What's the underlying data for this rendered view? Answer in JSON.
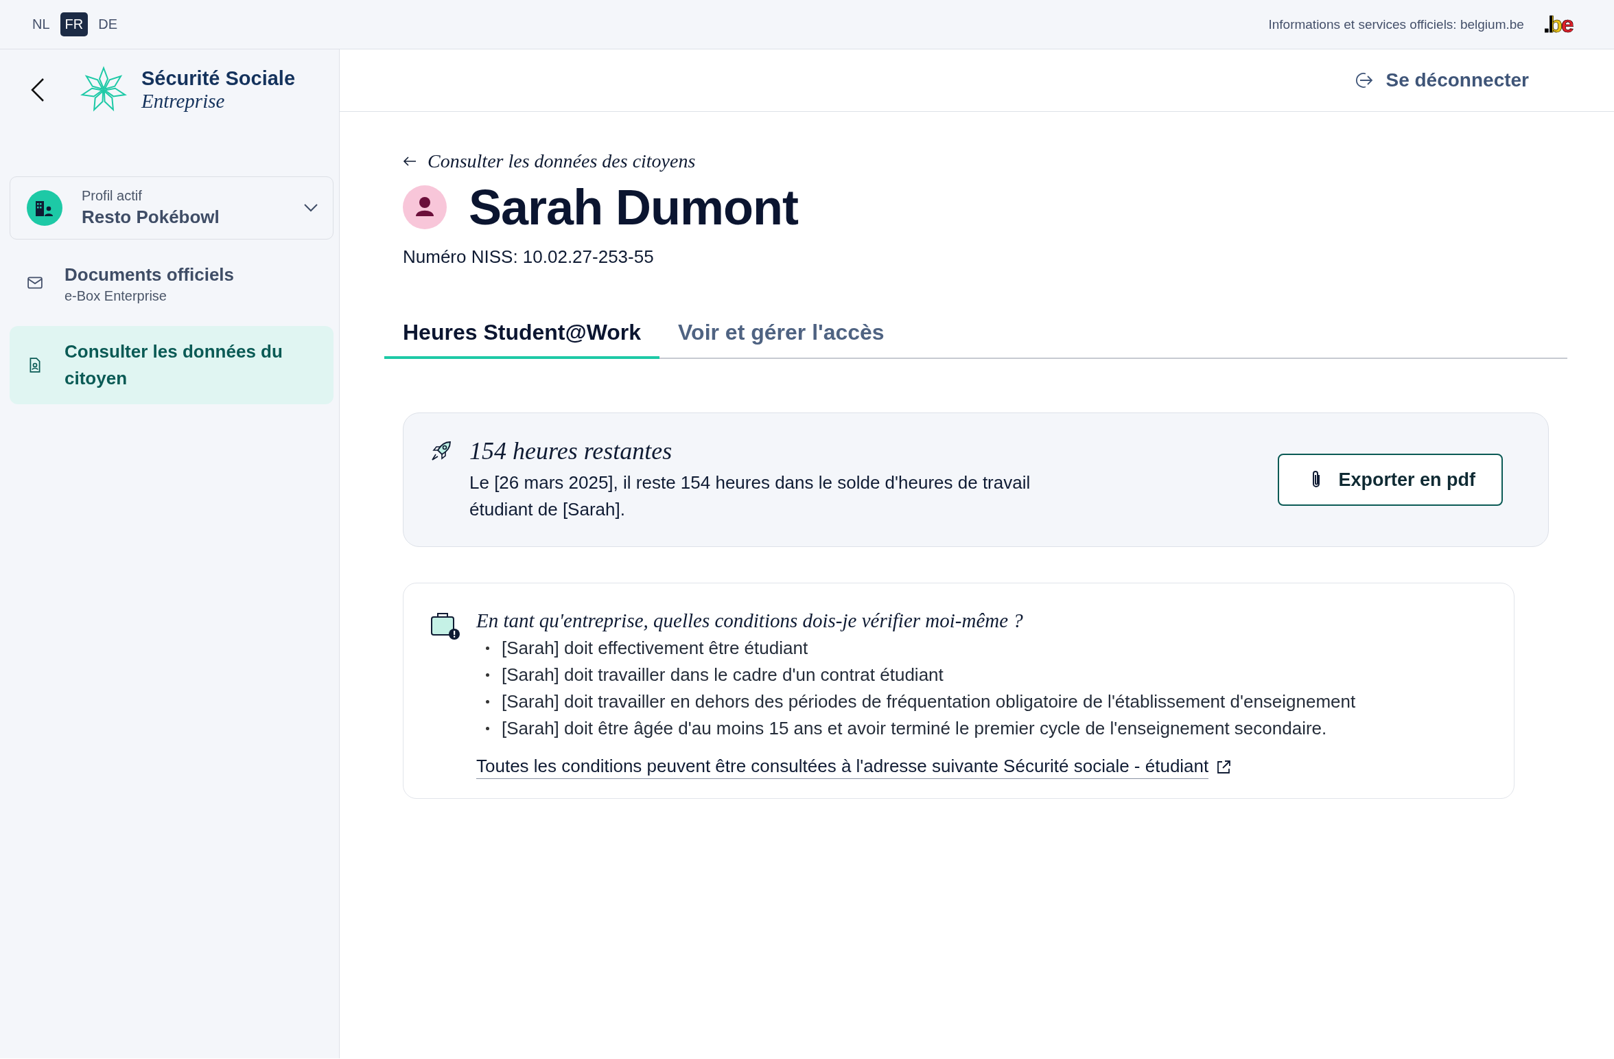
{
  "top_bar": {
    "languages": [
      {
        "label": "NL",
        "selected": false
      },
      {
        "label": "FR",
        "selected": true
      },
      {
        "label": "DE",
        "selected": false
      }
    ],
    "info_text": "Informations et services officiels: belgium.be",
    "brand": ".be"
  },
  "logo": {
    "title": "Sécurité Sociale",
    "subtitle": "Entreprise"
  },
  "header": {
    "logout": "Se déconnecter"
  },
  "sidebar": {
    "profile": {
      "label": "Profil actif",
      "name": "Resto Pokébowl"
    },
    "items": [
      {
        "title": "Documents officiels",
        "subtitle": "e-Box Enterprise",
        "selected": false
      },
      {
        "title": "Consulter les données du citoyen",
        "selected": true
      }
    ]
  },
  "citizen": {
    "breadcrumb": "Consulter les données des citoyens",
    "name": "Sarah Dumont",
    "niss": "Numéro NISS: 10.02.27-253-55"
  },
  "tabs": [
    {
      "label": "Heures Student@Work",
      "selected": true
    },
    {
      "label": "Voir et gérer l'accès",
      "selected": false
    }
  ],
  "hours_card": {
    "title": "154 heures restantes",
    "text": "Le [26 mars 2025], il reste 154 heures dans le solde d'heures de travail étudiant de [Sarah].",
    "button": "Exporter en pdf"
  },
  "conditions_card": {
    "title": "En tant qu'entreprise, quelles conditions dois-je vérifier moi-même ?",
    "items": [
      "[Sarah] doit effectivement être étudiant",
      "[Sarah] doit travailler dans le cadre d'un contrat étudiant",
      "[Sarah] doit travailler en dehors des périodes de fréquentation obligatoire de l'établissement d'enseignement",
      "[Sarah] doit être âgée d'au moins 15 ans et avoir terminé le premier cycle de l'enseignement secondaire."
    ],
    "link": "Toutes les conditions peuvent être consultées à l'adresse suivante Sécurité sociale - étudiant"
  }
}
